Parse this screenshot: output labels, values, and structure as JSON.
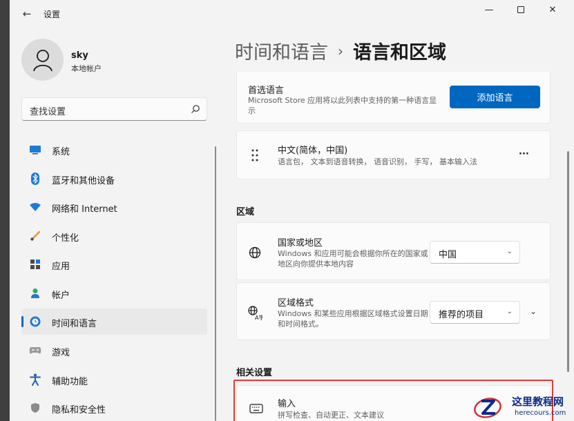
{
  "titlebar": {
    "back": "←",
    "title": "设置",
    "minimize": "—",
    "close": "✕"
  },
  "user": {
    "name": "sky",
    "type": "本地帐户"
  },
  "search": {
    "placeholder": "查找设置"
  },
  "nav": [
    {
      "label": "系统",
      "icon": "monitor-icon"
    },
    {
      "label": "蓝牙和其他设备",
      "icon": "bluetooth-icon"
    },
    {
      "label": "网络和 Internet",
      "icon": "wifi-icon"
    },
    {
      "label": "个性化",
      "icon": "brush-icon"
    },
    {
      "label": "应用",
      "icon": "apps-icon"
    },
    {
      "label": "帐户",
      "icon": "person-icon"
    },
    {
      "label": "时间和语言",
      "icon": "clock-globe-icon",
      "active": true
    },
    {
      "label": "游戏",
      "icon": "gamepad-icon"
    },
    {
      "label": "辅助功能",
      "icon": "accessibility-icon"
    },
    {
      "label": "隐私和安全性",
      "icon": "shield-icon"
    }
  ],
  "breadcrumb": {
    "parent": "时间和语言",
    "separator": "›",
    "current": "语言和区域"
  },
  "preferred_language": {
    "title": "首选语言",
    "desc": "Microsoft Store 应用将以此列表中支持的第一种语言显示",
    "button": "添加语言"
  },
  "language_item": {
    "title": "中文(简体，中国)",
    "desc": "语言包， 文本到语音转换， 语音识别， 手写， 基本输入法",
    "more": "···"
  },
  "region": {
    "heading": "区域",
    "country": {
      "title": "国家或地区",
      "desc": "Windows 和应用可能会根据你所在的国家或地区向你提供本地内容",
      "value": "中国"
    },
    "format": {
      "title": "区域格式",
      "desc": "Windows 和某些应用根据区域格式设置日期和时间格式。",
      "value": "推荐的项目"
    }
  },
  "related": {
    "heading": "相关设置",
    "input": {
      "title": "输入",
      "desc": "拼写检查、自动更正、文本建议"
    }
  },
  "watermark": {
    "site": "这里教程网",
    "url": "herecours.com"
  },
  "colors": {
    "accent": "#0067c0",
    "highlight": "#e53935",
    "background": "#f3f3f3",
    "card": "#fbfbfb"
  }
}
